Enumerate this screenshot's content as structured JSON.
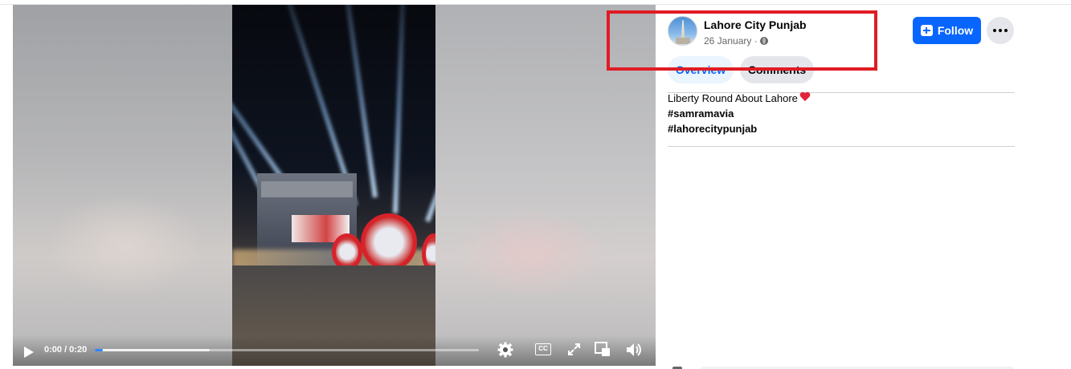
{
  "video": {
    "time_display": "0:00 / 0:20",
    "played_fraction": 0.02,
    "buffered_fraction": 0.3,
    "cc_label": "CC",
    "icons": [
      "play-icon",
      "settings-gear-icon",
      "closed-captions-icon",
      "fullscreen-expand-icon",
      "picture-in-picture-icon",
      "volume-icon"
    ]
  },
  "post": {
    "page_name": "Lahore City Punjab",
    "date": "26 January",
    "date_separator": " ·",
    "follow_label": "Follow",
    "tabs": [
      {
        "label": "Overview",
        "active": true
      },
      {
        "label": "Comments",
        "active": false
      }
    ],
    "caption": "Liberty Round About Lahore",
    "hashtags": [
      "#samramavia",
      "#lahorecitypunjab"
    ]
  },
  "colors": {
    "accent": "#0866ff",
    "highlight": "#e01c24",
    "heart": "#e0243a"
  }
}
